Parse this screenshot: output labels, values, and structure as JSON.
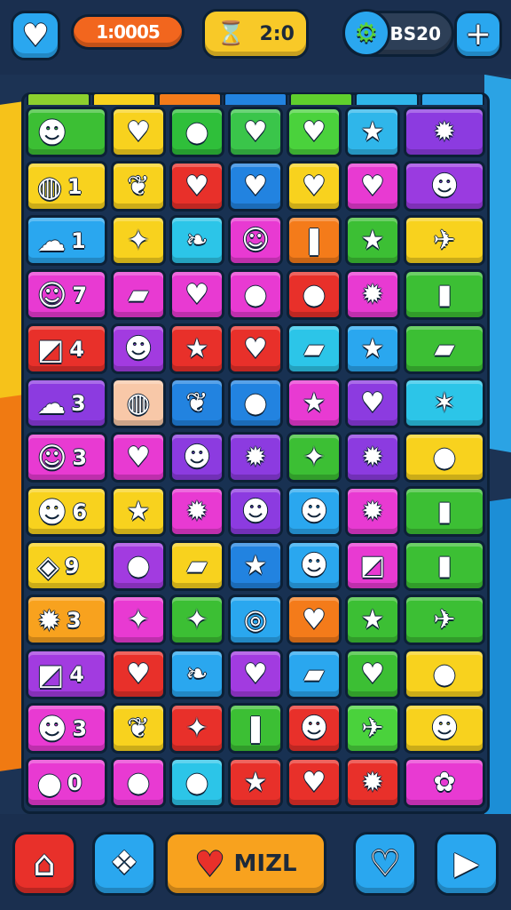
{
  "header": {
    "score": "1:0005",
    "moves": "2:0",
    "coins": "BS20"
  },
  "icons": {
    "heart_button": "heart-icon",
    "moves_badge": "hourglass-icon",
    "settings": "gear-icon",
    "add": "plus-icon",
    "home": "home-icon",
    "share": "share-icon",
    "like": "heart-icon",
    "play": "play-icon"
  },
  "colors": {
    "blue": "#2aa7ef",
    "orange": "#f2661e",
    "yellow": "#f8c928",
    "red": "#e8302a",
    "navy": "#1a2f4f"
  },
  "board": {
    "column_colors": [
      "#8cd02e",
      "#f8d21e",
      "#f47b1a",
      "#2283e0",
      "#5fcf2d",
      "#2fb6ea",
      "#2fa7ec"
    ],
    "rows": [
      {
        "count": "",
        "tiles": [
          {
            "g": "☻",
            "c": "#3cbf34"
          },
          {
            "g": "♥",
            "c": "#f8d21e"
          },
          {
            "g": "●",
            "c": "#2fbf3a"
          },
          {
            "g": "♥",
            "c": "#3ac54a"
          },
          {
            "g": "♥",
            "c": "#4ad23c"
          },
          {
            "g": "★",
            "c": "#2fb6ea"
          },
          {
            "g": "✹",
            "c": "#8c3be0"
          }
        ]
      },
      {
        "count": "1",
        "tiles": [
          {
            "g": "◍",
            "c": "#f8d21e"
          },
          {
            "g": "❦",
            "c": "#f8d21e"
          },
          {
            "g": "♥",
            "c": "#e8302a"
          },
          {
            "g": "♥",
            "c": "#2283e0"
          },
          {
            "g": "♥",
            "c": "#f8d21e"
          },
          {
            "g": "♥",
            "c": "#e83ad2"
          },
          {
            "g": "☻",
            "c": "#9a3be0"
          }
        ]
      },
      {
        "count": "1",
        "tiles": [
          {
            "g": "☁",
            "c": "#2aa7ef"
          },
          {
            "g": "✦",
            "c": "#f8d21e"
          },
          {
            "g": "❧",
            "c": "#2cc5e8"
          },
          {
            "g": "☺",
            "c": "#e83ad2"
          },
          {
            "g": "❚",
            "c": "#f47b1a"
          },
          {
            "g": "★",
            "c": "#3cbf34"
          },
          {
            "g": "✈",
            "c": "#f8d21e"
          }
        ]
      },
      {
        "count": "7",
        "tiles": [
          {
            "g": "☺",
            "c": "#e83ad2"
          },
          {
            "g": "▰",
            "c": "#e83ad2"
          },
          {
            "g": "♥",
            "c": "#e83ad2"
          },
          {
            "g": "●",
            "c": "#e83ad2"
          },
          {
            "g": "●",
            "c": "#e8302a"
          },
          {
            "g": "✹",
            "c": "#e83ad2"
          },
          {
            "g": "▮",
            "c": "#3cbf34"
          }
        ]
      },
      {
        "count": "4",
        "tiles": [
          {
            "g": "◩",
            "c": "#e8302a"
          },
          {
            "g": "☻",
            "c": "#a23be0"
          },
          {
            "g": "★",
            "c": "#e8302a"
          },
          {
            "g": "♥",
            "c": "#e8302a"
          },
          {
            "g": "▰",
            "c": "#2cc5e8"
          },
          {
            "g": "★",
            "c": "#2aa7ef"
          },
          {
            "g": "▰",
            "c": "#3cbf34"
          }
        ]
      },
      {
        "count": "3",
        "tiles": [
          {
            "g": "☁",
            "c": "#8c3be0"
          },
          {
            "g": "◍",
            "c": "#f8c8a8"
          },
          {
            "g": "❦",
            "c": "#2283e0"
          },
          {
            "g": "●",
            "c": "#2283e0"
          },
          {
            "g": "★",
            "c": "#e83ad2"
          },
          {
            "g": "♥",
            "c": "#8c3be0"
          },
          {
            "g": "✶",
            "c": "#2cc5e8"
          }
        ]
      },
      {
        "count": "3",
        "tiles": [
          {
            "g": "☺",
            "c": "#e83ad2"
          },
          {
            "g": "♥",
            "c": "#e83ad2"
          },
          {
            "g": "☻",
            "c": "#8c3be0"
          },
          {
            "g": "✹",
            "c": "#8c3be0"
          },
          {
            "g": "✦",
            "c": "#3cbf34"
          },
          {
            "g": "✹",
            "c": "#8c3be0"
          },
          {
            "g": "●",
            "c": "#f8d21e"
          }
        ]
      },
      {
        "count": "6",
        "tiles": [
          {
            "g": "☻",
            "c": "#f8d21e"
          },
          {
            "g": "★",
            "c": "#f8d21e"
          },
          {
            "g": "✹",
            "c": "#e83ad2"
          },
          {
            "g": "☻",
            "c": "#8c3be0"
          },
          {
            "g": "☻",
            "c": "#2aa7ef"
          },
          {
            "g": "✹",
            "c": "#e83ad2"
          },
          {
            "g": "▮",
            "c": "#3cbf34"
          }
        ]
      },
      {
        "count": "9",
        "tiles": [
          {
            "g": "◈",
            "c": "#f8d21e"
          },
          {
            "g": "●",
            "c": "#a23be0"
          },
          {
            "g": "▰",
            "c": "#f8d21e"
          },
          {
            "g": "★",
            "c": "#2283e0"
          },
          {
            "g": "☻",
            "c": "#2aa7ef"
          },
          {
            "g": "◩",
            "c": "#e83ad2"
          },
          {
            "g": "▮",
            "c": "#3cbf34"
          }
        ]
      },
      {
        "count": "3",
        "tiles": [
          {
            "g": "✹",
            "c": "#f8a21e"
          },
          {
            "g": "✦",
            "c": "#e83ad2"
          },
          {
            "g": "✦",
            "c": "#3cbf34"
          },
          {
            "g": "◎",
            "c": "#2aa7ef"
          },
          {
            "g": "♥",
            "c": "#f47b1a"
          },
          {
            "g": "★",
            "c": "#3cbf34"
          },
          {
            "g": "✈",
            "c": "#3cbf34"
          }
        ]
      },
      {
        "count": "4",
        "tiles": [
          {
            "g": "◩",
            "c": "#a23be0"
          },
          {
            "g": "♥",
            "c": "#e8302a"
          },
          {
            "g": "❧",
            "c": "#2aa7ef"
          },
          {
            "g": "♥",
            "c": "#a23be0"
          },
          {
            "g": "▰",
            "c": "#2aa7ef"
          },
          {
            "g": "♥",
            "c": "#3cbf34"
          },
          {
            "g": "●",
            "c": "#f8d21e"
          }
        ]
      },
      {
        "count": "3",
        "tiles": [
          {
            "g": "☻",
            "c": "#e83ad2"
          },
          {
            "g": "❦",
            "c": "#f8d21e"
          },
          {
            "g": "✦",
            "c": "#e8302a"
          },
          {
            "g": "❚",
            "c": "#3cbf34"
          },
          {
            "g": "☻",
            "c": "#e8302a"
          },
          {
            "g": "✈",
            "c": "#4ad23c"
          },
          {
            "g": "☻",
            "c": "#f8d21e"
          }
        ]
      },
      {
        "count": "0",
        "tiles": [
          {
            "g": "●",
            "c": "#e83ad2"
          },
          {
            "g": "●",
            "c": "#e83ad2"
          },
          {
            "g": "●",
            "c": "#2cc5e8"
          },
          {
            "g": "★",
            "c": "#e8302a"
          },
          {
            "g": "♥",
            "c": "#e8302a"
          },
          {
            "g": "✹",
            "c": "#e8302a"
          },
          {
            "g": "✿",
            "c": "#e83ad2"
          }
        ]
      }
    ]
  },
  "footer": {
    "action_label": "MIZL"
  }
}
